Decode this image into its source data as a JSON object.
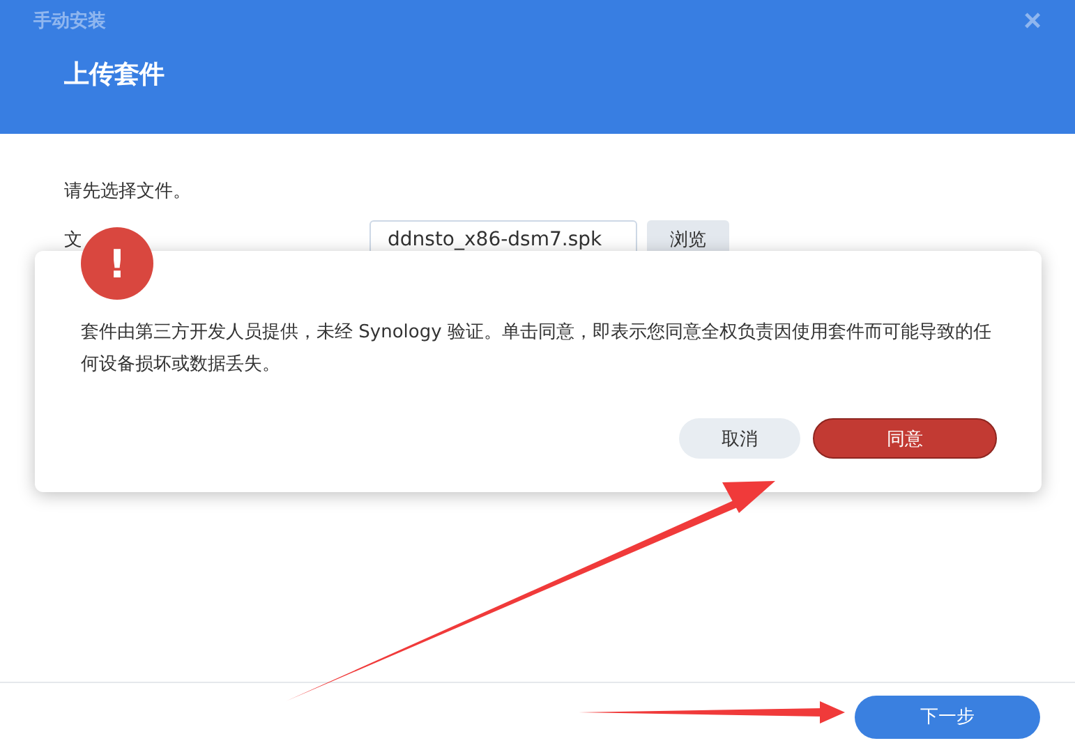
{
  "window": {
    "title": "手动安装",
    "close": "×"
  },
  "header": {
    "title": "上传套件"
  },
  "form": {
    "instruction": "请先选择文件。",
    "file_label": "文",
    "file_value": "ddnsto_x86-dsm7.spk",
    "browse_button": "浏览"
  },
  "alert": {
    "icon": "!",
    "message": "套件由第三方开发人员提供，未经 Synology 验证。单击同意，即表示您同意全权负责因使用套件而可能导致的任何设备损坏或数据丢失。",
    "buttons": [
      {
        "label": "取消",
        "kind": "secondary"
      },
      {
        "label": "同意",
        "kind": "primary"
      }
    ]
  },
  "footer": {
    "next_button": "下一步"
  }
}
